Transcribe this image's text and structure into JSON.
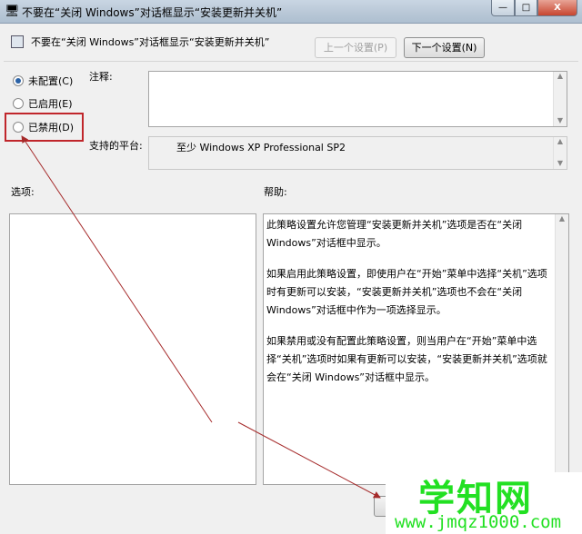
{
  "window": {
    "title": "不要在“关闭 Windows”对话框显示“安装更新并关机”",
    "minimize": "—",
    "maximize": "□",
    "close": "X"
  },
  "header": {
    "title": "不要在“关闭 Windows”对话框显示“安装更新并关机”",
    "prev_button": "上一个设置(P)",
    "next_button": "下一个设置(N)"
  },
  "radios": [
    {
      "label": "未配置(C)",
      "checked": true
    },
    {
      "label": "已启用(E)",
      "checked": false
    },
    {
      "label": "已禁用(D)",
      "checked": false
    }
  ],
  "comment_label": "注释:",
  "platform_label": "支持的平台:",
  "platform_value": "至少 Windows XP Professional SP2",
  "options_label": "选项:",
  "help_label": "帮助:",
  "help_paragraphs": [
    "此策略设置允许您管理“安装更新并关机”选项是否在“关闭 Windows”对话框中显示。",
    "如果启用此策略设置，即使用户在“开始”菜单中选择“关机”选项时有更新可以安装，“安装更新并关机”选项也不会在“关闭 Windows”对话框中作为一项选择显示。",
    "如果禁用或没有配置此策略设置，则当用户在“开始”菜单中选择“关机”选项时如果有更新可以安装，“安装更新并关机”选项就会在“关闭 Windows”对话框中显示。"
  ],
  "watermark": {
    "name": "学知网",
    "url": "www.jmqz1000.com"
  },
  "colors": {
    "annotation": "#c0262b",
    "watermark": "#22e022"
  }
}
